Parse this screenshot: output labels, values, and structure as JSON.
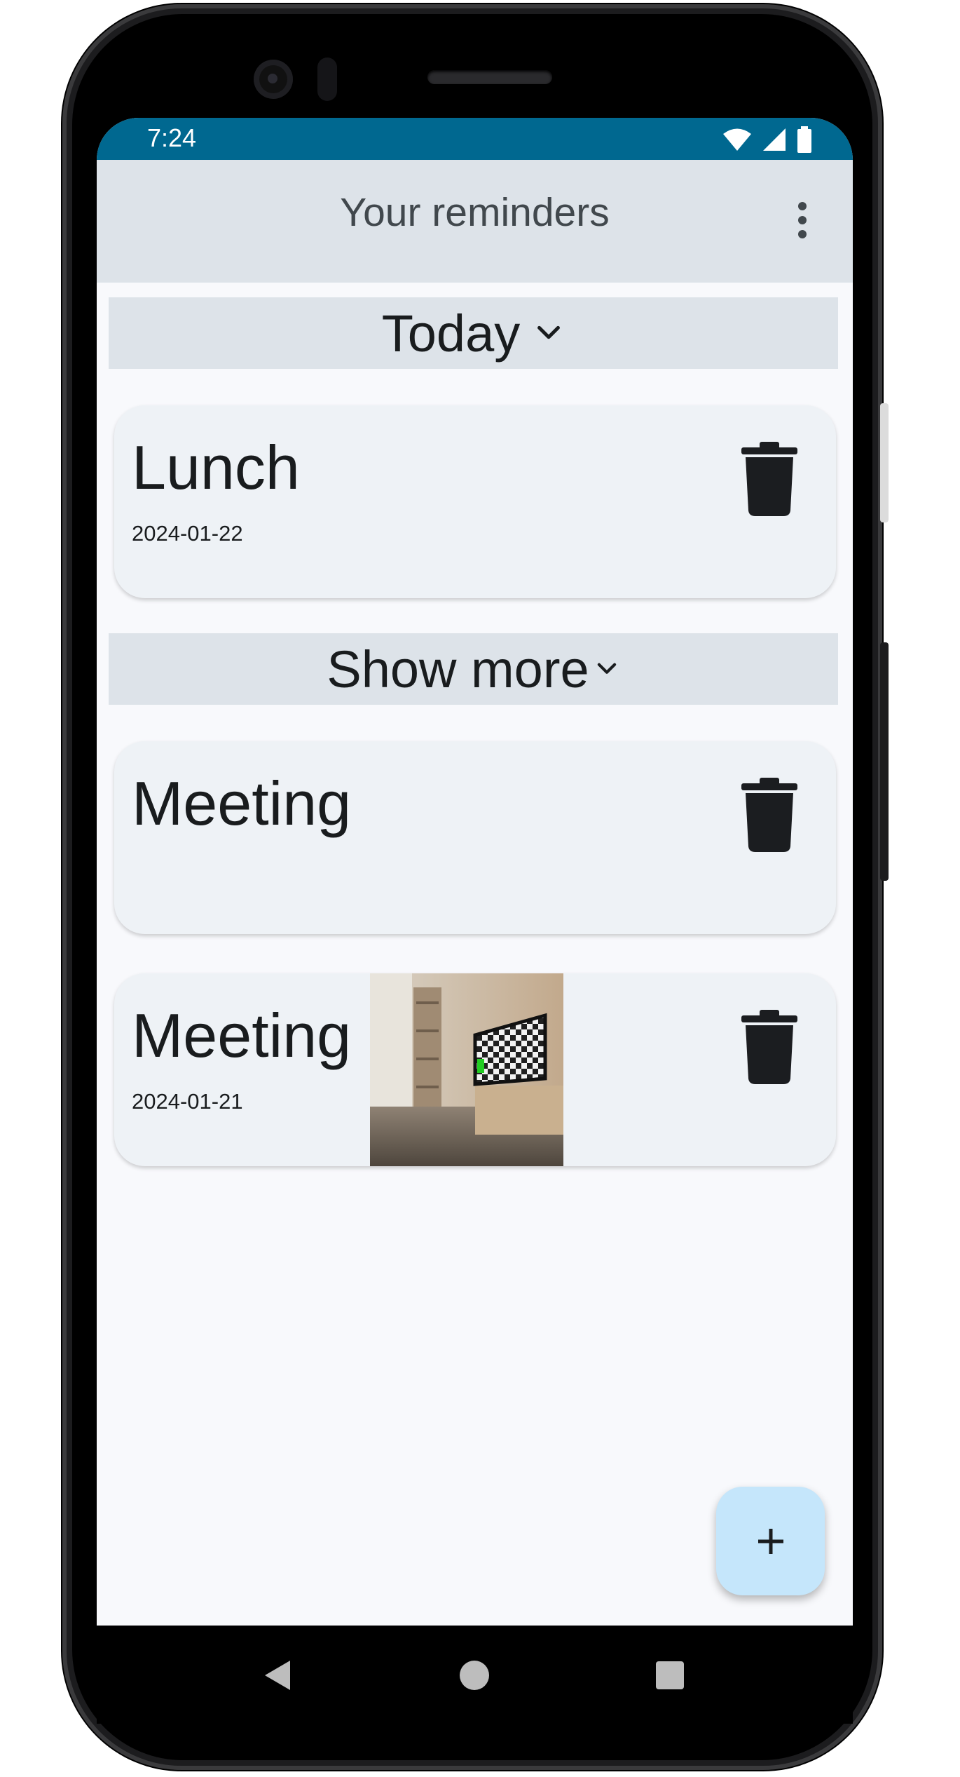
{
  "status_bar": {
    "time": "7:24",
    "icons": [
      "wifi-icon",
      "cell-signal-icon",
      "battery-icon"
    ],
    "color": "#006890"
  },
  "app_bar": {
    "title": "Your reminders",
    "menu_icon": "more-vert-icon"
  },
  "sections": {
    "today": {
      "label": "Today",
      "icon": "chevron-down-icon"
    },
    "more": {
      "label": "Show more",
      "icon": "chevron-down-icon"
    }
  },
  "reminders": [
    {
      "title": "Lunch",
      "date": "2024-01-22",
      "delete_icon": "trash-icon"
    },
    {
      "title": "Meeting",
      "date": "",
      "delete_icon": "trash-icon"
    },
    {
      "title": "Meeting",
      "date": "2024-01-21",
      "delete_icon": "trash-icon",
      "image": "room-photo-thumbnail"
    }
  ],
  "fab": {
    "label": "+",
    "icon": "add-icon",
    "color": "#c5e6fb"
  },
  "nav_bar": {
    "icons": [
      "back-icon",
      "home-icon",
      "recents-icon"
    ]
  },
  "colors": {
    "header_bg": "#dde3e9",
    "card_bg": "#eef2f6",
    "screen_bg": "#f8f9fc",
    "text": "#191c1e"
  }
}
